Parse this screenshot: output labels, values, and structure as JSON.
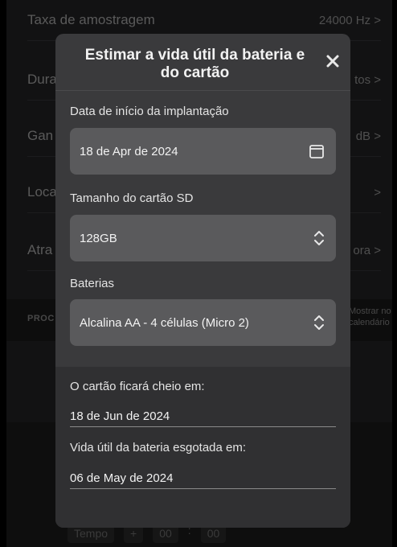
{
  "background": {
    "rows": [
      {
        "label": "Taxa de amostragem",
        "value": "24000 Hz >"
      },
      {
        "label": "Dura",
        "value": "tos >"
      },
      {
        "label": "Gan",
        "value": "dB >"
      },
      {
        "label": "Loca",
        "value": ">"
      },
      {
        "label": "Atra",
        "value": "ora >"
      }
    ],
    "section_label": "PROC",
    "calendar_text": "Mostrar no calendário",
    "controls": [
      "Tempo",
      "+",
      "00",
      ":",
      "00"
    ]
  },
  "modal": {
    "title": "Estimar a vida útil da bateria e do cartão",
    "close_icon": "close-icon",
    "start_date": {
      "label": "Data de início da implantação",
      "value": "18 de Apr de 2024",
      "icon": "calendar-icon"
    },
    "sd_card": {
      "label": "Tamanho do cartão SD",
      "value": "128GB",
      "icon": "chevron-updown-icon"
    },
    "batteries": {
      "label": "Baterias",
      "value": "Alcalina AA - 4 células (Micro 2)",
      "icon": "chevron-updown-icon"
    },
    "card_full": {
      "label": "O cartão ficará cheio em:",
      "value": "18 de Jun de 2024"
    },
    "battery_depleted": {
      "label": "Vida útil da bateria esgotada em:",
      "value": "06 de May de 2024"
    }
  }
}
